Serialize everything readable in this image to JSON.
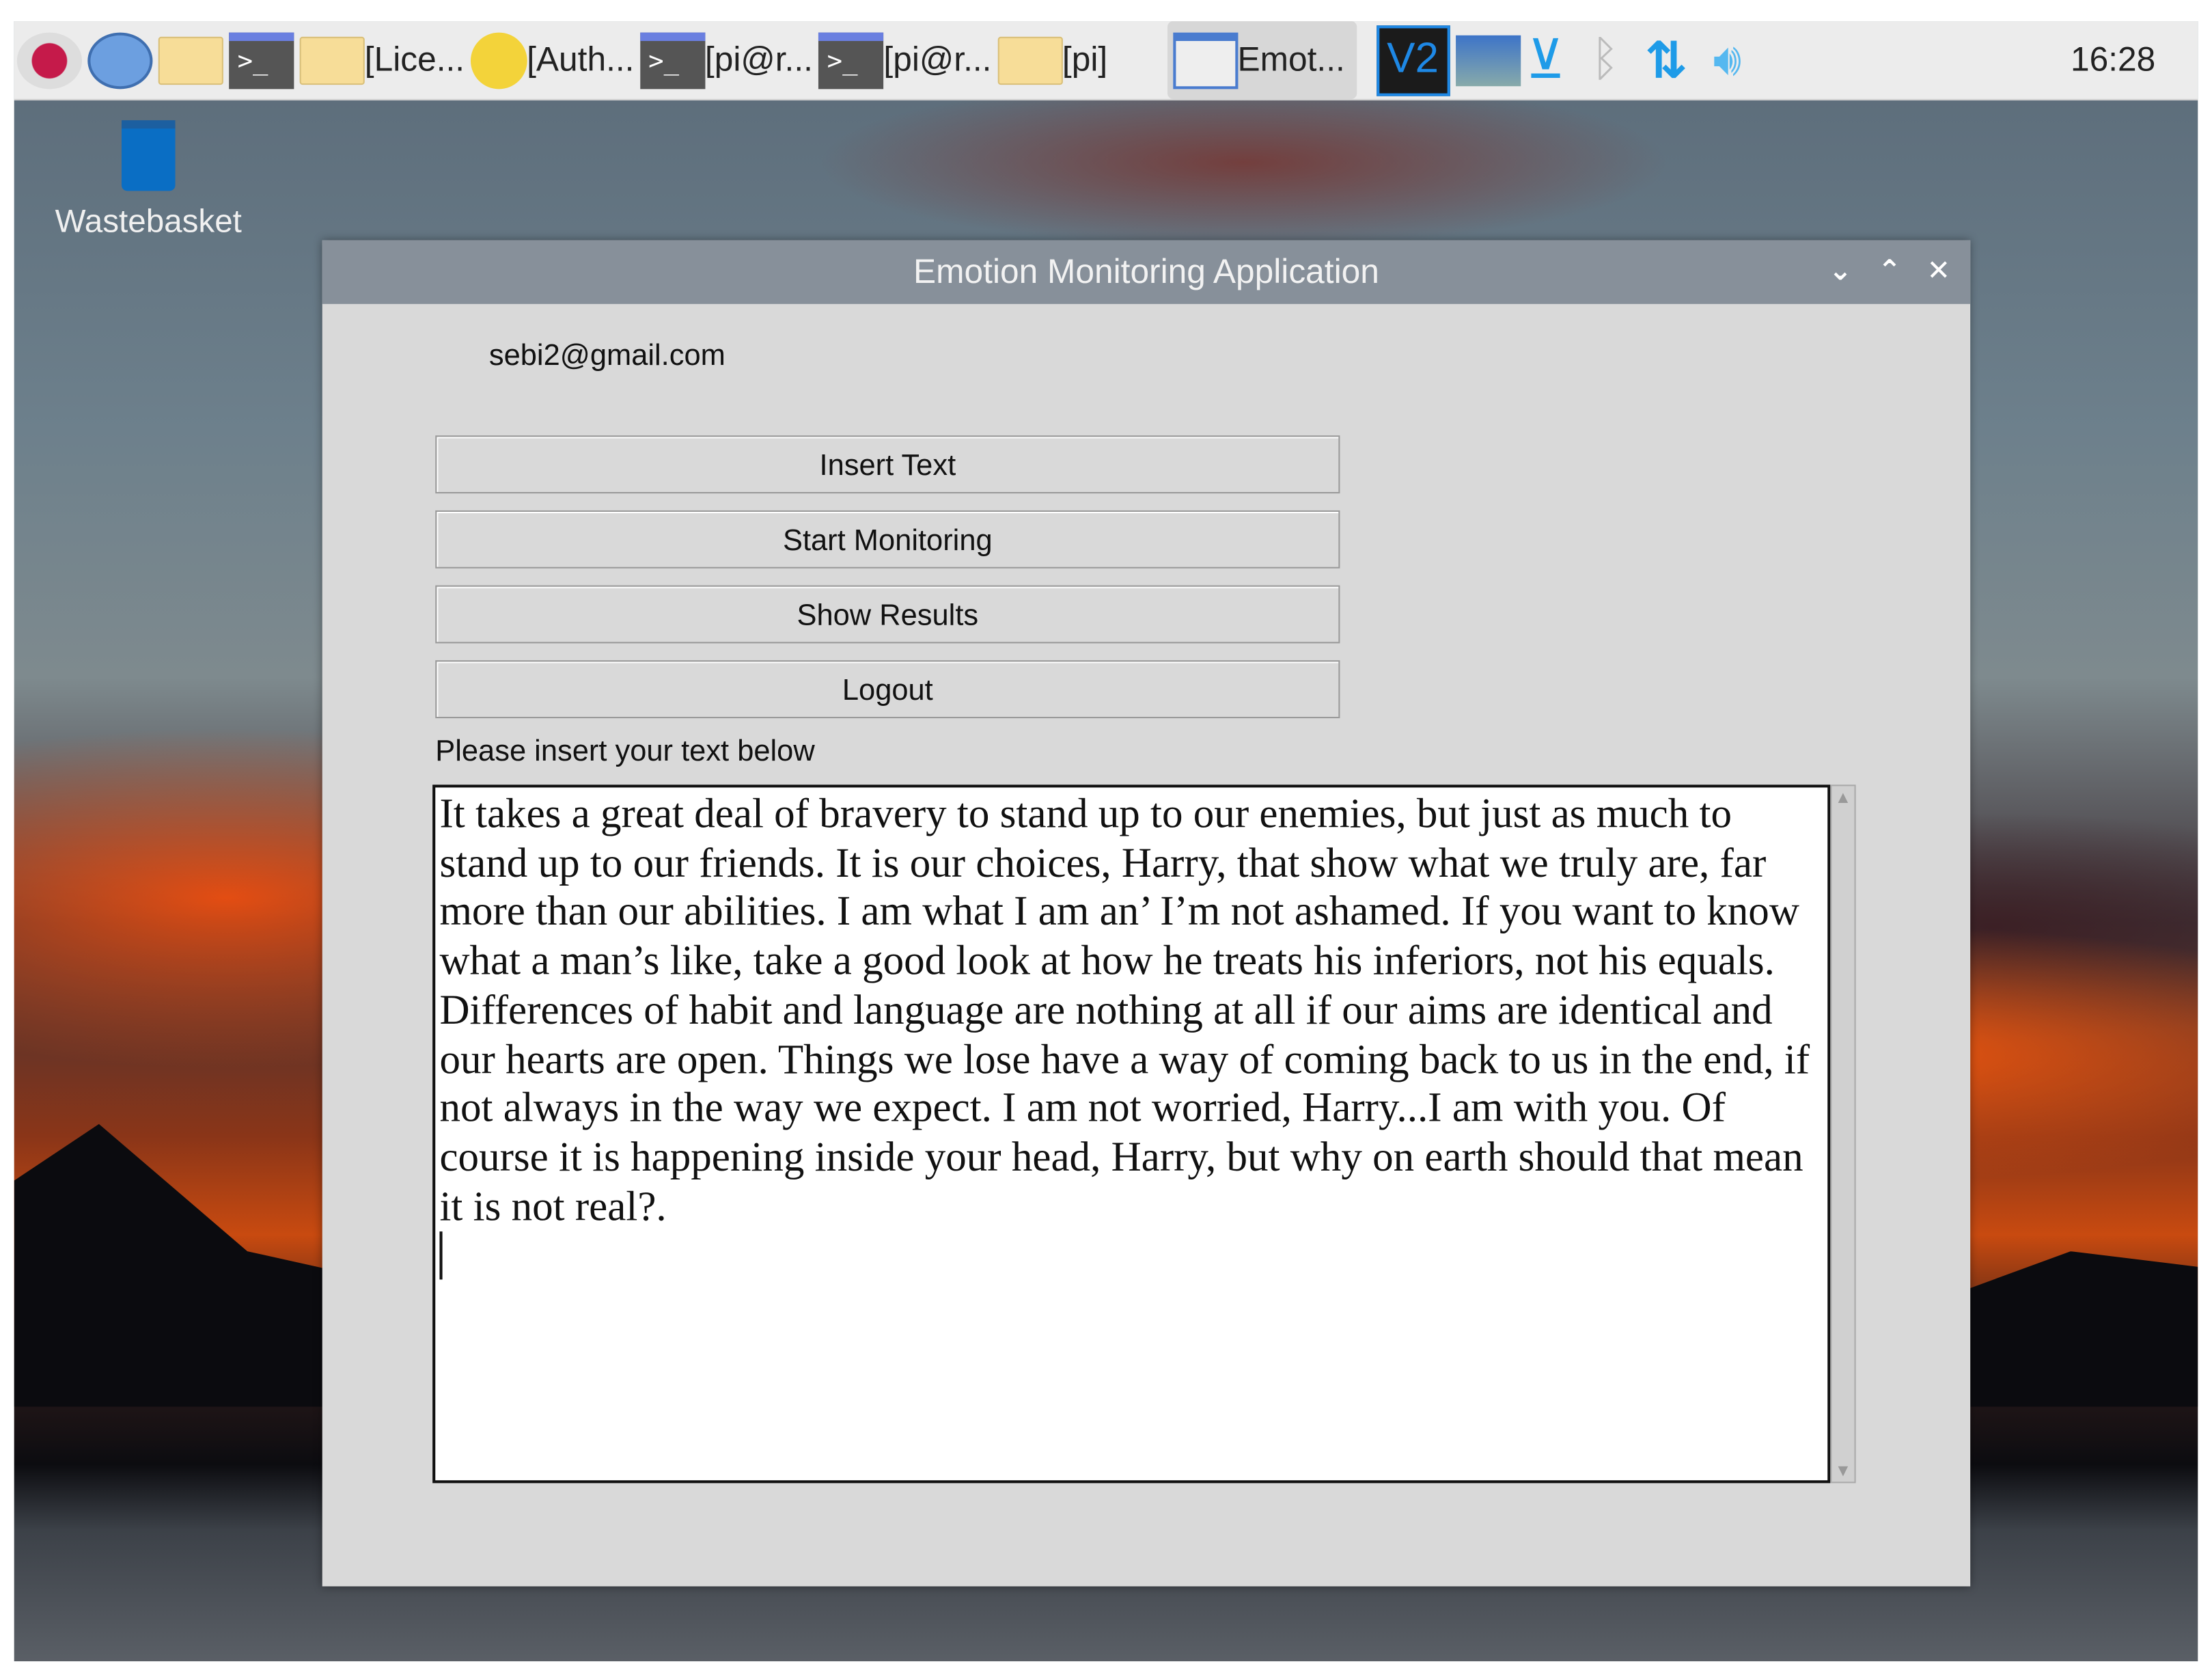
{
  "taskbar": {
    "items": [
      {
        "label": "",
        "icon": "raspberry-menu-icon"
      },
      {
        "label": "",
        "icon": "browser-globe-icon"
      },
      {
        "label": "",
        "icon": "file-manager-icon"
      },
      {
        "label": "",
        "icon": "terminal-icon"
      },
      {
        "label": "[Lice...",
        "icon": "folder-icon"
      },
      {
        "label": "[Auth...",
        "icon": "authentication-icon"
      },
      {
        "label": "[pi@r...",
        "icon": "terminal-icon"
      },
      {
        "label": "[pi@r...",
        "icon": "terminal-icon"
      },
      {
        "label": "[pi]",
        "icon": "folder-icon"
      },
      {
        "label": "Emot...",
        "icon": "window-icon"
      }
    ],
    "tray": [
      "vnc-icon",
      "network-icon",
      "download-icon",
      "bluetooth-icon",
      "data-transfer-icon",
      "volume-icon"
    ],
    "clock": "16:28"
  },
  "desktop": {
    "wastebasket": "Wastebasket"
  },
  "window": {
    "title": "Emotion Monitoring Application",
    "controls": {
      "minimize": "⌄",
      "maximize": "⌃",
      "close": "✕"
    },
    "email": "sebi2@gmail.com",
    "buttons": {
      "insert_text": "Insert Text",
      "start_monitoring": "Start Monitoring",
      "show_results": "Show Results",
      "logout": "Logout"
    },
    "prompt_label": "Please insert your text below",
    "text_value": "It takes a great deal of bravery to stand up to our enemies, but just as much to stand up to our friends. It is our choices, Harry, that show what we truly are, far more than our abilities. I am what I am an’ I’m not ashamed. If you want to know what a man’s like, take a good look at how he treats his inferiors, not his equals. Differences of habit and language are nothing at all if our aims are identical and our hearts are open. Things we lose have a way of coming back to us in the end, if not always in the way we expect. I am not worried, Harry...I am with you. Of course it is happening inside your head, Harry, but why on earth should that mean it is not real?.\n"
  }
}
